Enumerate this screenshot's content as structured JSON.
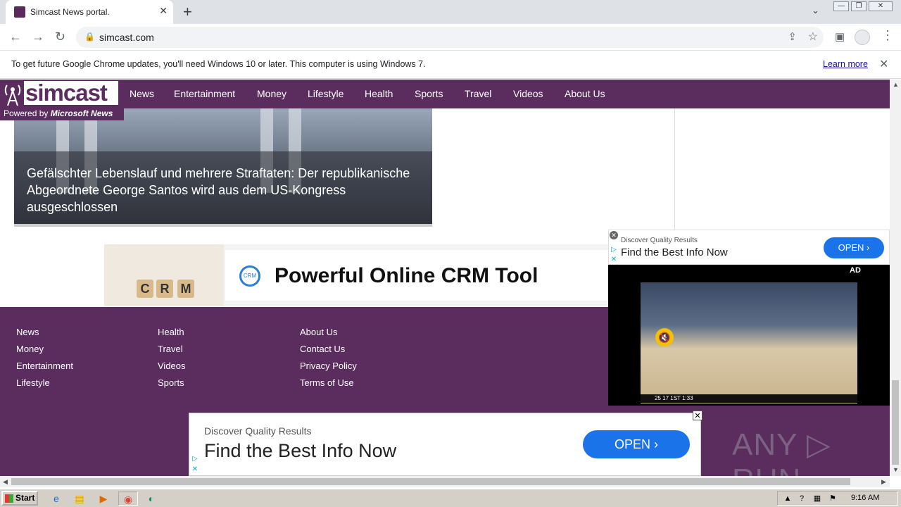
{
  "browser": {
    "tab_title": "Simcast News portal.",
    "tab_close": "✕",
    "new_tab": "+",
    "url": "simcast.com",
    "back": "←",
    "forward": "→",
    "reload": "↻",
    "lock": "🔒",
    "share": "⇪",
    "star": "☆",
    "sidepanel": "▣",
    "menu": "⋮",
    "tabsearch": "⌄",
    "win_min": "—",
    "win_max": "❐",
    "win_close": "✕"
  },
  "infobar": {
    "message": "To get future Google Chrome updates, you'll need Windows 10 or later. This computer is using Windows 7.",
    "learn_more": "Learn more",
    "close": "✕"
  },
  "site": {
    "logo": "simcast",
    "powered_prefix": "Powered by ",
    "powered_brand": "Microsoft News",
    "nav": [
      "News",
      "Entertainment",
      "Money",
      "Lifestyle",
      "Health",
      "Sports",
      "Travel",
      "Videos",
      "About Us"
    ],
    "hero_headline": "Gefälschter Lebenslauf und mehrere Straftaten: Der republikanische Abgeordnete George Santos wird aus dem US-Kongress ausgeschlossen",
    "crm_ad": {
      "title": "Powerful Online CRM Tool",
      "circle": "CRM",
      "cubes": [
        "C",
        "R",
        "M"
      ]
    },
    "footer": {
      "col1": [
        "News",
        "Money",
        "Entertainment",
        "Lifestyle"
      ],
      "col2": [
        "Health",
        "Travel",
        "Videos",
        "Sports"
      ],
      "col3": [
        "About Us",
        "Contact Us",
        "Privacy Policy",
        "Terms of Use"
      ]
    },
    "watermark": "ANY ▷ RUN"
  },
  "side_ad": {
    "subtitle": "Discover Quality Results",
    "headline": "Find the Best Info Now",
    "button": "OPEN  ›",
    "video_label": "AD",
    "mute": "🔇",
    "scoreline": "25     17   1ST  1:33"
  },
  "bottom_ad": {
    "subtitle": "Discover Quality Results",
    "headline": "Find the Best Info Now",
    "button": "OPEN  ›",
    "close": "✕"
  },
  "taskbar": {
    "start": "Start",
    "clock": "9:16 AM"
  },
  "colors": {
    "brand_purple": "#5a2d5e",
    "ad_button_blue": "#1a73e8"
  }
}
